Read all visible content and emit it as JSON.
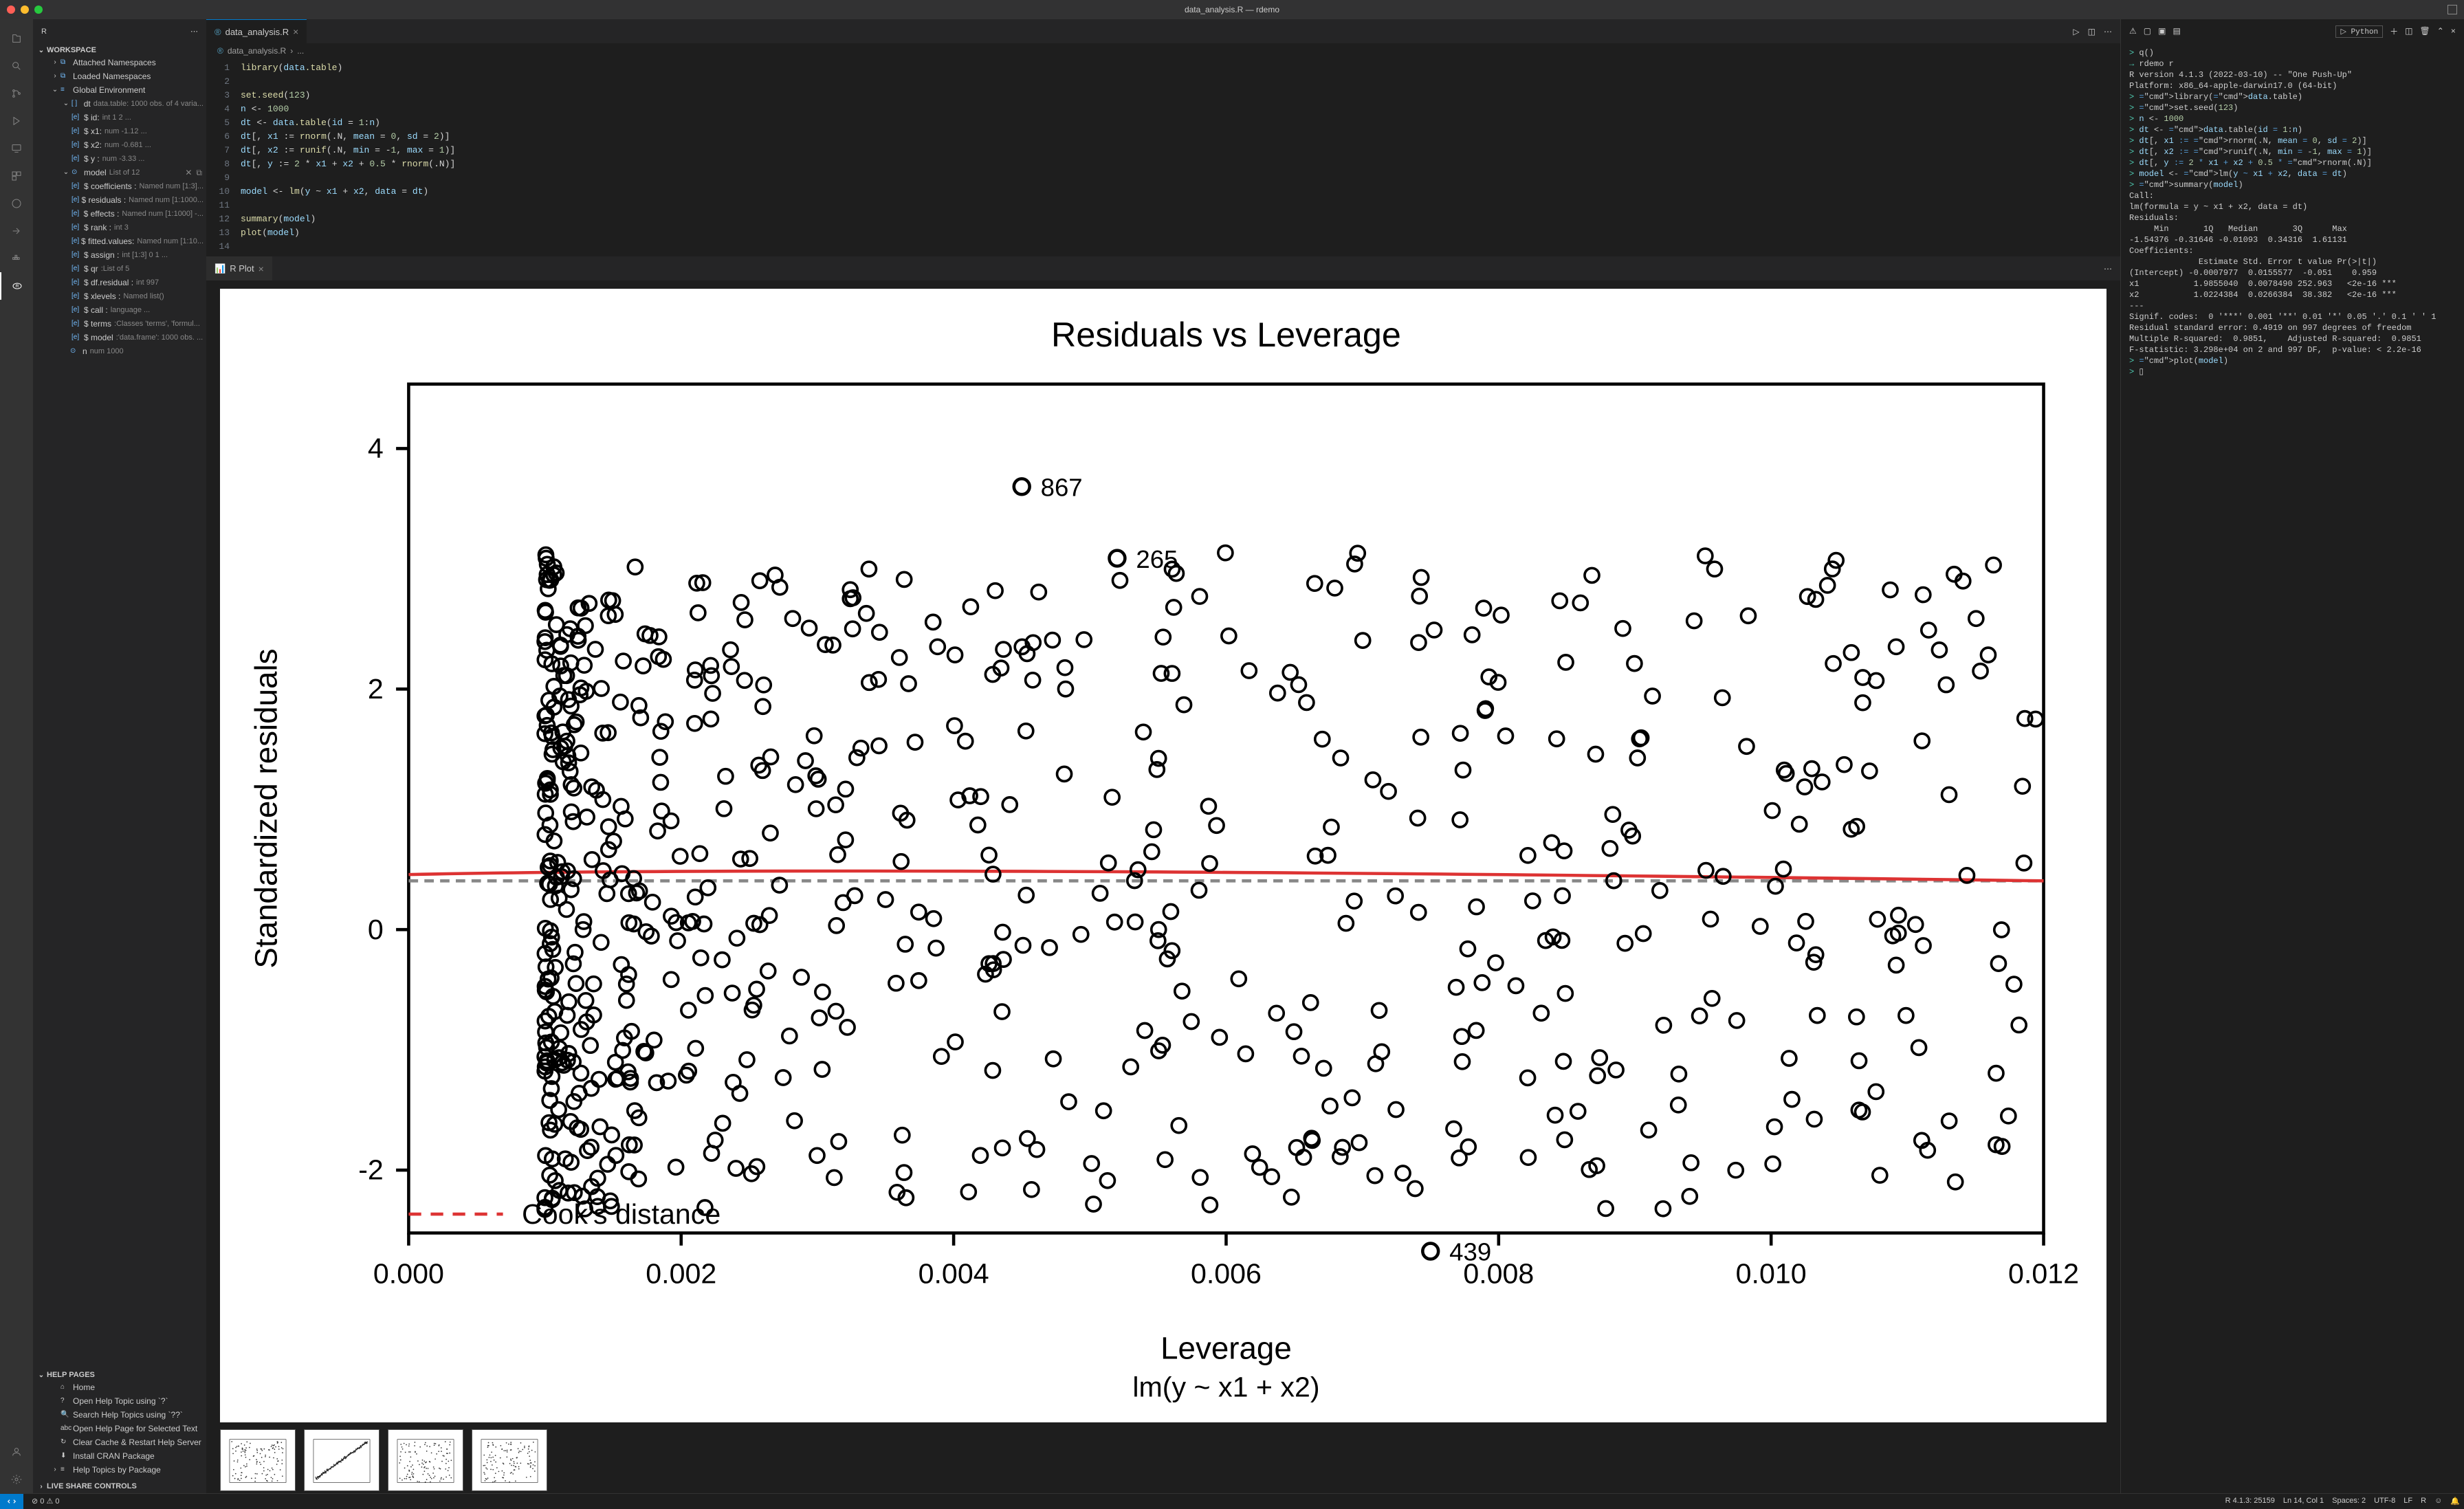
{
  "window": {
    "title": "data_analysis.R — rdemo"
  },
  "sidebar": {
    "title": "R",
    "sections": {
      "workspace": {
        "label": "WORKSPACE",
        "items": [
          {
            "label": "Attached Namespaces"
          },
          {
            "label": "Loaded Namespaces"
          },
          {
            "label": "Global Environment",
            "expanded": true
          }
        ]
      },
      "dt": {
        "name": "dt",
        "type": "data.table: 1000 obs. of 4 varia..."
      },
      "dt_children": [
        {
          "name": "$ id:",
          "type": "int 1 2 ..."
        },
        {
          "name": "$ x1:",
          "type": "num -1.12 ..."
        },
        {
          "name": "$ x2:",
          "type": "num -0.681 ..."
        },
        {
          "name": "$ y :",
          "type": "num -3.33 ..."
        }
      ],
      "model": {
        "name": "model",
        "type": "List of 12"
      },
      "model_children": [
        {
          "name": "$ coefficients :",
          "type": "Named num [1:3]..."
        },
        {
          "name": "$ residuals :",
          "type": "Named num [1:1000..."
        },
        {
          "name": "$ effects :",
          "type": "Named num [1:1000] -..."
        },
        {
          "name": "$ rank :",
          "type": "int 3"
        },
        {
          "name": "$ fitted.values:",
          "type": "Named num [1:10..."
        },
        {
          "name": "$ assign :",
          "type": "int [1:3] 0 1 ..."
        },
        {
          "name": "$ qr",
          "type": ":List of 5"
        },
        {
          "name": "$ df.residual :",
          "type": "int 997"
        },
        {
          "name": "$ xlevels :",
          "type": "Named list()"
        },
        {
          "name": "$ call :",
          "type": "language ..."
        },
        {
          "name": "$ terms",
          "type": ":Classes 'terms', 'formul..."
        },
        {
          "name": "$ model",
          "type": ":'data.frame': 1000 obs. ..."
        }
      ],
      "n": {
        "name": "n",
        "type": "num 1000"
      }
    },
    "help": {
      "label": "HELP PAGES",
      "items": [
        "Home",
        "Open Help Topic using `?`",
        "Search Help Topics using `??`",
        "Open Help Page for Selected Text",
        "Clear Cache & Restart Help Server",
        "Install CRAN Package",
        "Help Topics by Package"
      ]
    },
    "liveshare": "LIVE SHARE CONTROLS"
  },
  "editor": {
    "tab": "data_analysis.R",
    "breadcrumb": [
      "data_analysis.R",
      "..."
    ],
    "lines": [
      "library(data.table)",
      "",
      "set.seed(123)",
      "n <- 1000",
      "dt <- data.table(id = 1:n)",
      "dt[, x1 := rnorm(.N, mean = 0, sd = 2)]",
      "dt[, x2 := runif(.N, min = -1, max = 1)]",
      "dt[, y := 2 * x1 + x2 + 0.5 * rnorm(.N)]",
      "",
      "model <- lm(y ~ x1 + x2, data = dt)",
      "",
      "summary(model)",
      "plot(model)",
      ""
    ]
  },
  "plot": {
    "tab": "R Plot",
    "title": "Residuals vs Leverage",
    "xlabel": "Leverage",
    "ylabel": "Standardized residuals",
    "sublabel": "lm(y ~ x1 + x2)",
    "cooks": "Cook's distance",
    "annotations": [
      "867",
      "265",
      "439"
    ],
    "yticks": [
      "-2",
      "0",
      "2",
      "4"
    ],
    "xticks": [
      "0.000",
      "0.002",
      "0.004",
      "0.006",
      "0.008",
      "0.010",
      "0.012"
    ]
  },
  "terminal": {
    "kernel": "Python",
    "lines": [
      {
        "p": ">",
        "t": "q()"
      },
      {
        "p": "→",
        "t": "rdemo r",
        "c": "#4ec9b0"
      },
      {
        "t": "R version 4.1.3 (2022-03-10) -- \"One Push-Up\""
      },
      {
        "t": "Platform: x86_64-apple-darwin17.0 (64-bit)"
      },
      {
        "t": ""
      },
      {
        "p": ">",
        "h": "library(data.table)"
      },
      {
        "t": ""
      },
      {
        "p": ">",
        "h": "set.seed(123)"
      },
      {
        "t": ""
      },
      {
        "p": ">",
        "h": "n <- 1000"
      },
      {
        "t": ""
      },
      {
        "p": ">",
        "h": "dt <- data.table(id = 1:n)"
      },
      {
        "t": ""
      },
      {
        "p": ">",
        "h": "dt[, x1 := rnorm(.N, mean = 0, sd = 2)]"
      },
      {
        "t": ""
      },
      {
        "p": ">",
        "h": "dt[, x2 := runif(.N, min = -1, max = 1)]"
      },
      {
        "t": ""
      },
      {
        "p": ">",
        "h": "dt[, y := 2 * x1 + x2 + 0.5 * rnorm(.N)]"
      },
      {
        "t": ""
      },
      {
        "p": ">",
        "h": "model <- lm(y ~ x1 + x2, data = dt)"
      },
      {
        "t": ""
      },
      {
        "p": ">",
        "h": "summary(model)"
      },
      {
        "t": ""
      },
      {
        "t": "Call:"
      },
      {
        "t": "lm(formula = y ~ x1 + x2, data = dt)"
      },
      {
        "t": ""
      },
      {
        "t": "Residuals:"
      },
      {
        "t": "     Min       1Q   Median       3Q      Max"
      },
      {
        "t": "-1.54376 -0.31646 -0.01093  0.34316  1.61131"
      },
      {
        "t": ""
      },
      {
        "t": "Coefficients:"
      },
      {
        "t": "              Estimate Std. Error t value Pr(>|t|)"
      },
      {
        "t": "(Intercept) -0.0007977  0.0155577  -0.051    0.959"
      },
      {
        "t": "x1           1.9855040  0.0078490 252.963   <2e-16 ***"
      },
      {
        "t": "x2           1.0224384  0.0266384  38.382   <2e-16 ***"
      },
      {
        "t": "---"
      },
      {
        "t": "Signif. codes:  0 '***' 0.001 '**' 0.01 '*' 0.05 '.' 0.1 ' ' 1"
      },
      {
        "t": ""
      },
      {
        "t": "Residual standard error: 0.4919 on 997 degrees of freedom"
      },
      {
        "t": "Multiple R-squared:  0.9851,\tAdjusted R-squared:  0.9851"
      },
      {
        "t": "F-statistic: 3.298e+04 on 2 and 997 DF,  p-value: < 2.2e-16"
      },
      {
        "t": ""
      },
      {
        "p": ">",
        "h": "plot(model)"
      },
      {
        "t": ""
      },
      {
        "p": ">",
        "t": "▯"
      }
    ]
  },
  "status": {
    "errors": "0",
    "warnings": "0",
    "r": "R 4.1.3: 25159",
    "pos": "Ln 14, Col 1",
    "spaces": "Spaces: 2",
    "enc": "UTF-8",
    "eol": "LF",
    "lang": "R"
  },
  "chart_data": {
    "type": "scatter",
    "title": "Residuals vs Leverage",
    "xlabel": "Leverage",
    "ylabel": "Standardized residuals",
    "xlim": [
      0,
      0.012
    ],
    "ylim": [
      -3,
      4
    ],
    "n_points": 1000,
    "annotations": [
      {
        "label": "867",
        "x": 0.0045,
        "y": 3.3
      },
      {
        "label": "265",
        "x": 0.0052,
        "y": 2.7
      },
      {
        "label": "439",
        "x": 0.0075,
        "y": -3.1
      }
    ],
    "cooks_line": true
  }
}
